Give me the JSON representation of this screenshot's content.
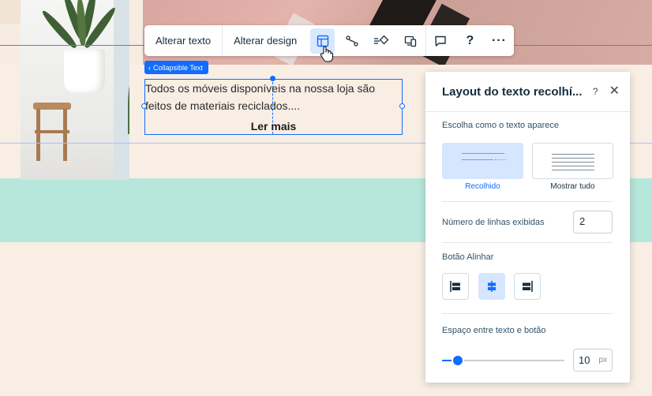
{
  "toolbar": {
    "change_text": "Alterar texto",
    "change_design": "Alterar design",
    "icons": [
      "layout-icon",
      "animation-icon",
      "connect-icon",
      "mobile-icon",
      "comment-icon",
      "help-icon",
      "more-icon"
    ],
    "help_glyph": "?",
    "more_glyph": "···"
  },
  "element": {
    "tag": "Collapsible Text",
    "text": "Todos os móveis disponíveis na nossa loja são feitos de materiais reciclados....",
    "read_more": "Ler mais"
  },
  "panel": {
    "title": "Layout do texto recolhí...",
    "help": "?",
    "close": "✕",
    "text_appearance_label": "Escolha como o texto aparece",
    "options": [
      {
        "label": "Recolhido",
        "selected": true
      },
      {
        "label": "Mostrar tudo",
        "selected": false
      }
    ],
    "lines_label": "Número de linhas exibidas",
    "lines_value": "2",
    "align_label": "Botão Alinhar",
    "align_options": [
      "align-left-icon",
      "align-center-icon",
      "align-right-icon"
    ],
    "align_selected": "center",
    "spacing_label": "Espaço entre texto e botão",
    "spacing_value": "10",
    "spacing_unit": "px",
    "spacing_fraction": 0.13
  },
  "colors": {
    "accent": "#116dff",
    "selected_bg": "#d6e6fe",
    "band": "#b7e6da",
    "page_bg": "#f8eee4"
  }
}
